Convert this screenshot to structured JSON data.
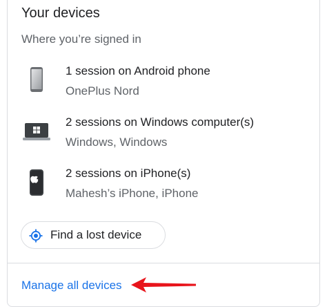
{
  "card": {
    "title": "Your devices",
    "subtitle": "Where you’re signed in"
  },
  "devices": [
    {
      "icon": "android-phone-icon",
      "sessions": "1 session on Android phone",
      "detail": "OnePlus Nord"
    },
    {
      "icon": "windows-laptop-icon",
      "sessions": "2 sessions on Windows computer(s)",
      "detail": "Windows, Windows"
    },
    {
      "icon": "iphone-icon",
      "sessions": "2 sessions on iPhone(s)",
      "detail": "Mahesh’s iPhone, iPhone"
    }
  ],
  "find_device": {
    "label": "Find a lost device",
    "icon": "location-target-icon"
  },
  "manage": {
    "label": "Manage all devices"
  },
  "colors": {
    "link": "#1a73e8",
    "arrow": "#e8141b",
    "border": "#dadce0",
    "secondary_text": "#5f6368",
    "primary_text": "#202124"
  }
}
